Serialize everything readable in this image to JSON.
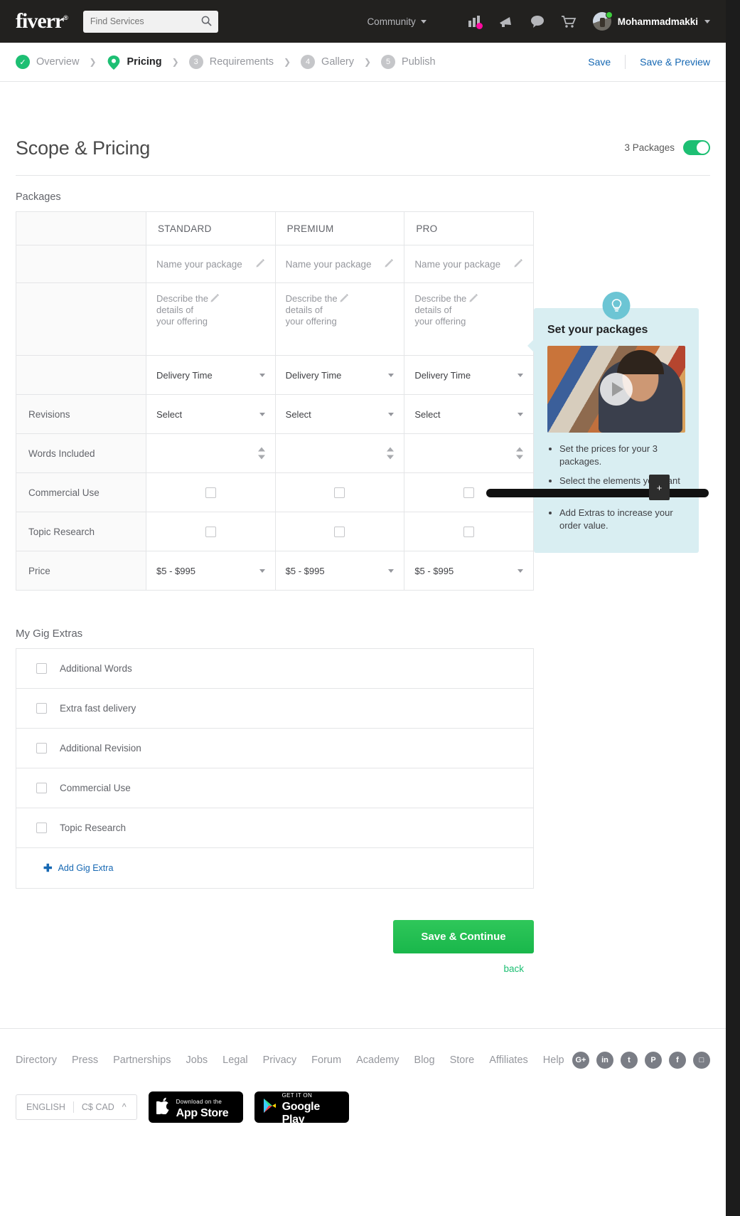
{
  "topnav": {
    "logo": "fiverr",
    "logo_reg": "®",
    "search_placeholder": "Find Services",
    "search_value": "",
    "community_label": "Community",
    "icons": [
      "analytics-icon",
      "megaphone-icon",
      "chat-icon",
      "cart-icon"
    ],
    "username": "Mohammadmakki"
  },
  "steps": [
    {
      "label": "Overview",
      "badge": "✓",
      "state": "done"
    },
    {
      "label": "Pricing",
      "badge": "pin",
      "state": "active"
    },
    {
      "label": "Requirements",
      "badge": "3",
      "state": "todo"
    },
    {
      "label": "Gallery",
      "badge": "4",
      "state": "todo"
    },
    {
      "label": "Publish",
      "badge": "5",
      "state": "todo"
    }
  ],
  "step_actions": {
    "save": "Save",
    "save_preview": "Save & Preview"
  },
  "heading": {
    "title": "Scope & Pricing",
    "packages_label": "3 Packages",
    "toggle_state": "on"
  },
  "packages_section_label": "Packages",
  "packages": {
    "columns": [
      "STANDARD",
      "PREMIUM",
      "PRO"
    ],
    "name_placeholder": "Name your package",
    "desc_placeholder": "Describe the details of your offering",
    "delivery_placeholder": "Delivery Time",
    "rows": [
      {
        "label": "Revisions",
        "value": "Select",
        "type": "select"
      },
      {
        "label": "Words Included",
        "value": "",
        "type": "stepper"
      },
      {
        "label": "Commercial Use",
        "value": "",
        "type": "checkbox"
      },
      {
        "label": "Topic Research",
        "value": "",
        "type": "checkbox"
      },
      {
        "label": "Price",
        "value": "$5 - $995",
        "type": "select"
      }
    ]
  },
  "help": {
    "title": "Set your packages",
    "icon": "lightbulb-icon",
    "bullets": [
      "Set the prices for your 3 packages.",
      "Select the elements you want to include in each offer.",
      "Add Extras to increase your order value."
    ],
    "zoom_plus": "+"
  },
  "extras": {
    "title": "My Gig Extras",
    "items": [
      "Additional Words",
      "Extra fast delivery",
      "Additional Revision",
      "Commercial Use",
      "Topic Research"
    ],
    "add_label": "Add Gig Extra",
    "add_icon": "plus-icon"
  },
  "actions": {
    "primary": "Save & Continue",
    "back": "back"
  },
  "footer": {
    "links": [
      "Directory",
      "Press",
      "Partnerships",
      "Jobs",
      "Legal",
      "Privacy",
      "Forum",
      "Academy",
      "Blog",
      "Store",
      "Affiliates",
      "Help"
    ],
    "social": [
      {
        "name": "google-plus-icon",
        "glyph": "G+"
      },
      {
        "name": "linkedin-icon",
        "glyph": "in"
      },
      {
        "name": "twitter-icon",
        "glyph": "t"
      },
      {
        "name": "pinterest-icon",
        "glyph": "P"
      },
      {
        "name": "facebook-icon",
        "glyph": "f"
      },
      {
        "name": "instagram-icon",
        "glyph": "□"
      }
    ],
    "language": "ENGLISH",
    "currency": "C$ CAD",
    "appstore": {
      "sub": "Download on the",
      "main": "App Store"
    },
    "googleplay": {
      "sub": "GET IT ON",
      "main": "Google Play"
    }
  },
  "colors": {
    "brand_green": "#1dbf73",
    "link_blue": "#1668b3",
    "help_bg": "#d9eef2"
  }
}
